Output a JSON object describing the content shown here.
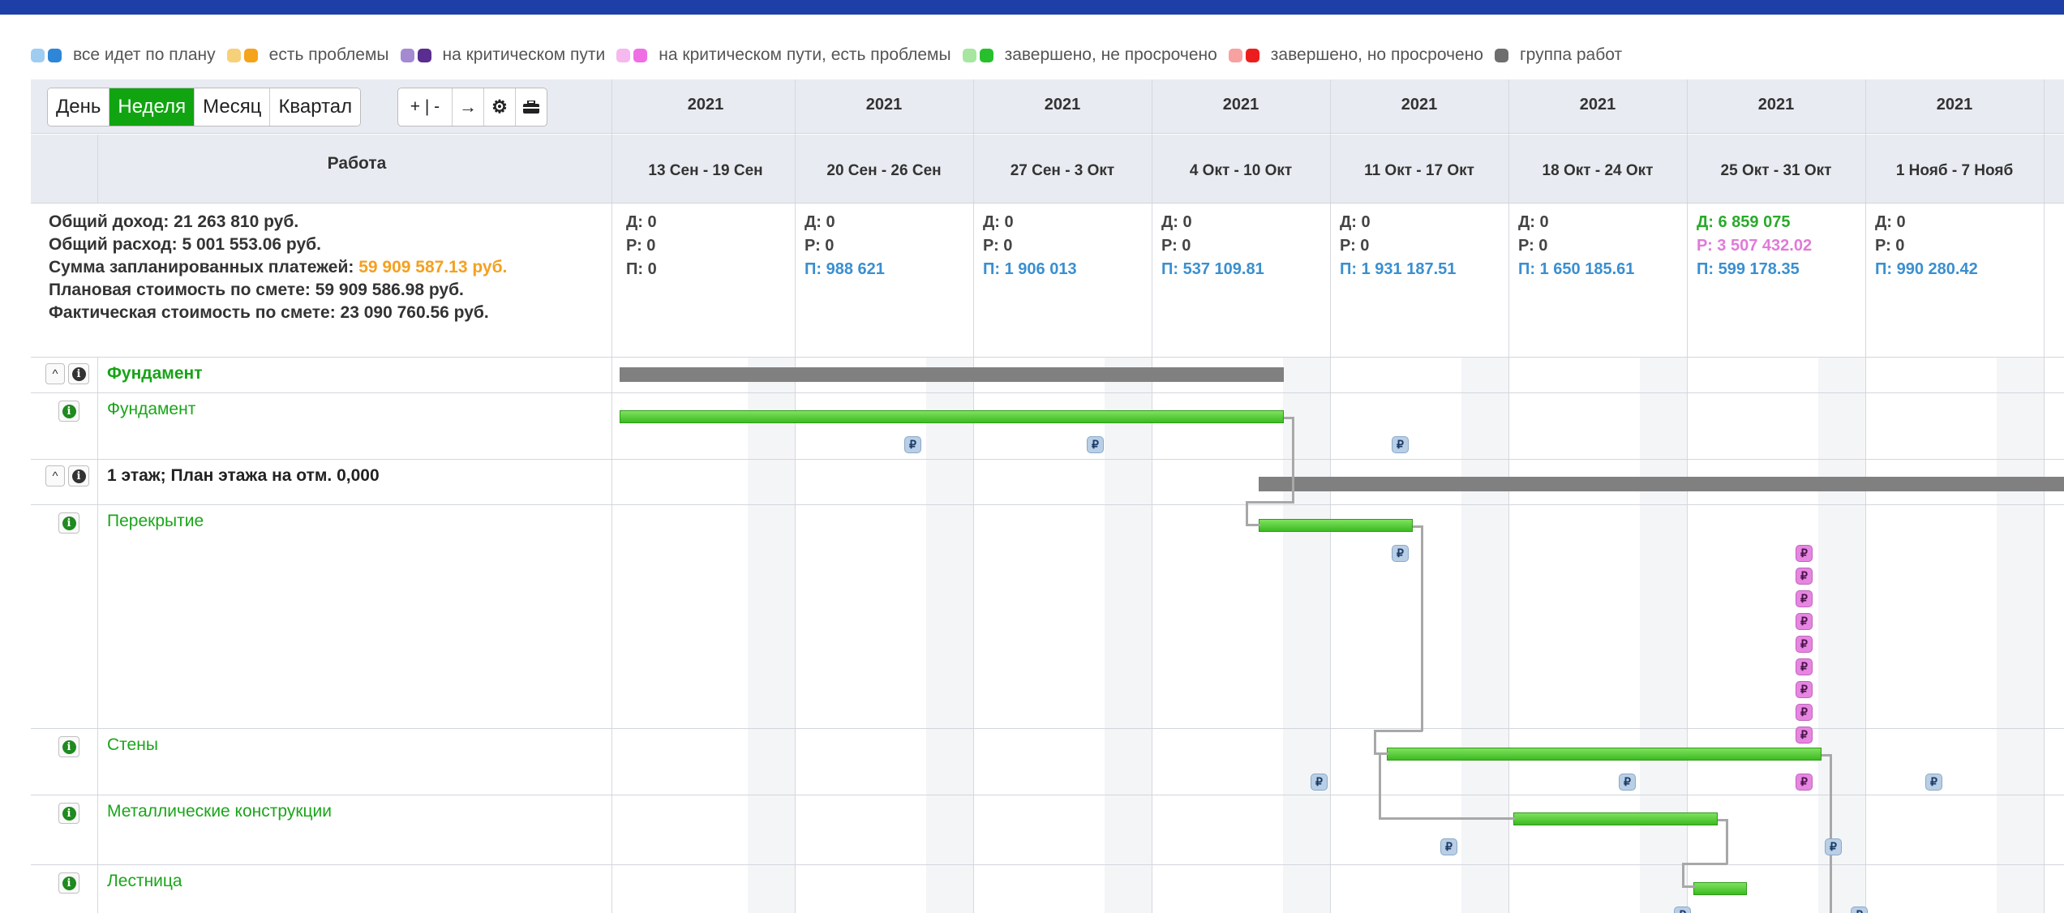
{
  "legend": [
    {
      "label": "все идет по плану",
      "light": "#9fcdf2",
      "dark": "#2d86d8"
    },
    {
      "label": "есть проблемы",
      "light": "#f7d07a",
      "dark": "#f5a31a"
    },
    {
      "label": "на критическом пути",
      "light": "#a48ad0",
      "dark": "#5a2d91"
    },
    {
      "label": "на критическом пути, есть проблемы",
      "light": "#f5b8ef",
      "dark": "#ef6ee4"
    },
    {
      "label": "завершено, не просрочено",
      "light": "#a6e6a0",
      "dark": "#27c02c"
    },
    {
      "label": "завершено, но просрочено",
      "light": "#f7a1a1",
      "dark": "#ee1d1d"
    },
    {
      "label": "группа работ",
      "light": null,
      "dark": "#6e6e6e"
    }
  ],
  "toolbar": {
    "views": [
      "День",
      "Неделя",
      "Месяц",
      "Квартал"
    ],
    "active_view": "Неделя",
    "zoom": "+ | -",
    "tool_icons": [
      "arrow-right-icon",
      "gear-icon",
      "briefcase-icon"
    ]
  },
  "table": {
    "work_header": "Работа"
  },
  "weeks": [
    {
      "year": "2021",
      "range": "13 Сен - 19 Сен",
      "d": "Д: 0",
      "p": "Р: 0",
      "plan": "П: 0",
      "d_color": "normal",
      "p_color": "normal",
      "plan_color": "normal"
    },
    {
      "year": "2021",
      "range": "20 Сен - 26 Сен",
      "d": "Д: 0",
      "p": "Р: 0",
      "plan": "П: 988 621",
      "d_color": "normal",
      "p_color": "normal",
      "plan_color": "blue"
    },
    {
      "year": "2021",
      "range": "27 Сен - 3 Окт",
      "d": "Д: 0",
      "p": "Р: 0",
      "plan": "П: 1 906 013",
      "d_color": "normal",
      "p_color": "normal",
      "plan_color": "blue"
    },
    {
      "year": "2021",
      "range": "4 Окт - 10 Окт",
      "d": "Д: 0",
      "p": "Р: 0",
      "plan": "П: 537 109.81",
      "d_color": "normal",
      "p_color": "normal",
      "plan_color": "blue"
    },
    {
      "year": "2021",
      "range": "11 Окт - 17 Окт",
      "d": "Д: 0",
      "p": "Р: 0",
      "plan": "П: 1 931 187.51",
      "d_color": "normal",
      "p_color": "normal",
      "plan_color": "blue"
    },
    {
      "year": "2021",
      "range": "18 Окт - 24 Окт",
      "d": "Д: 0",
      "p": "Р: 0",
      "plan": "П: 1 650 185.61",
      "d_color": "normal",
      "p_color": "normal",
      "plan_color": "blue"
    },
    {
      "year": "2021",
      "range": "25 Окт - 31 Окт",
      "d": "Д: 6 859 075",
      "p": "Р: 3 507 432.02",
      "plan": "П: 599 178.35",
      "d_color": "green",
      "p_color": "pink",
      "plan_color": "blue"
    },
    {
      "year": "2021",
      "range": "1 Нояб - 7 Нояб",
      "d": "Д: 0",
      "p": "Р: 0",
      "plan": "П: 990 280.42",
      "d_color": "normal",
      "p_color": "normal",
      "plan_color": "blue"
    }
  ],
  "summary": {
    "income": "Общий доход: 21 263 810 руб.",
    "expense": "Общий расход: 5 001 553.06 руб.",
    "planned_payments_label": "Сумма запланированных платежей: ",
    "planned_payments_value": "59 909 587.13 руб.",
    "planned_cost": "Плановая стоимость по смете: 59 909 586.98 руб.",
    "actual_cost": "Фактическая стоимость по смете: 23 090 760.56 руб."
  },
  "rows": [
    {
      "label": "Фундамент",
      "type": "group",
      "style": "green"
    },
    {
      "label": "Фундамент",
      "type": "task"
    },
    {
      "label": "1 этаж; План этажа на отм. 0,000",
      "type": "group",
      "style": "dark"
    },
    {
      "label": "Перекрытие",
      "type": "task"
    },
    {
      "label": "Стены",
      "type": "task"
    },
    {
      "label": "Металлические конструкции",
      "type": "task"
    },
    {
      "label": "Лестница",
      "type": "task"
    }
  ],
  "payment_marker": "₽"
}
